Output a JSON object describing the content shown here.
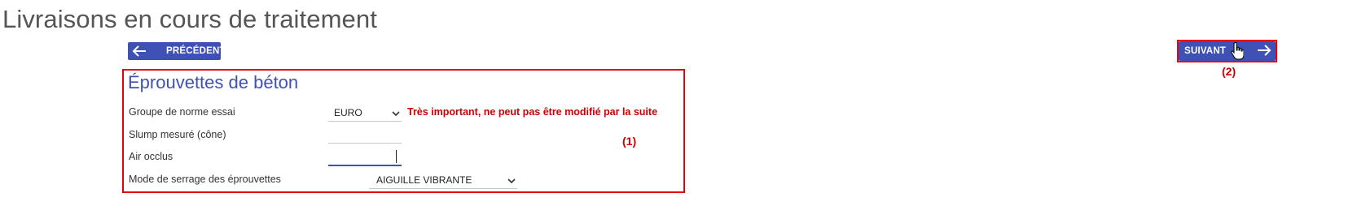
{
  "page": {
    "title": "Livraisons en cours de traitement"
  },
  "nav": {
    "prev_label": "PRÉCÉDENT",
    "next_label": "SUIVANT",
    "prev_icon": "arrow-left-icon",
    "next_icon": "arrow-right-icon",
    "button_color": "#3f51b5"
  },
  "form": {
    "title": "Éprouvettes de béton",
    "fields": [
      {
        "label": "Groupe de norme essai",
        "type": "select",
        "value": "EURO"
      },
      {
        "label": "Slump mesuré (cône)",
        "type": "text",
        "value": ""
      },
      {
        "label": "Air occlus",
        "type": "text",
        "value": "",
        "focused": true
      },
      {
        "label": "Mode de serrage des éprouvettes",
        "type": "select",
        "value": "AIGUILLE VIBRANTE"
      }
    ],
    "warning": "Très important, ne peut pas être modifié par la suite"
  },
  "annotations": {
    "callout_1": "(1)",
    "callout_2": "(2)",
    "color": "#e3000f"
  }
}
